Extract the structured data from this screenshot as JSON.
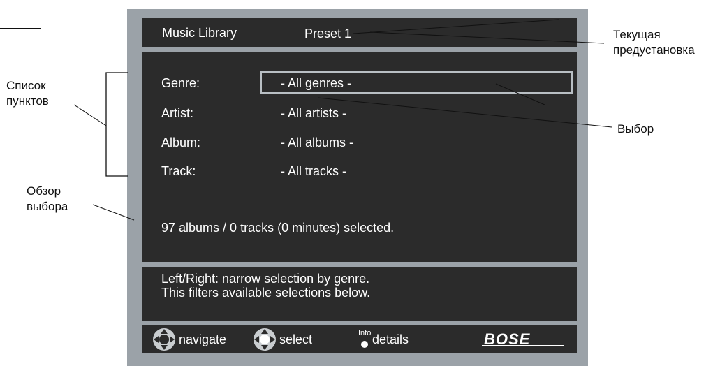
{
  "screen": {
    "title": "Music Library",
    "preset": "Preset 1",
    "fields": [
      {
        "label": "Genre:",
        "value": "- All genres -"
      },
      {
        "label": "Artist:",
        "value": "- All artists -"
      },
      {
        "label": "Album:",
        "value": "- All albums -"
      },
      {
        "label": "Track:",
        "value": "- All tracks -"
      }
    ],
    "summary": "97 albums / 0 tracks (0 minutes) selected.",
    "help_line1": "Left/Right: narrow selection by genre.",
    "help_line2": "This filters available selections below.",
    "footer": {
      "navigate": "navigate",
      "select": "select",
      "info": "Info",
      "details": "details",
      "logo": "BOSE"
    }
  },
  "annotations": {
    "current_preset_line1": "Текущая",
    "current_preset_line2": "предустановка",
    "item_list_line1": "Список",
    "item_list_line2": "пунктов",
    "selection": "Выбор",
    "overview_line1": "Обзор",
    "overview_line2": "выбора"
  },
  "colors": {
    "frame": "#9ba2a8",
    "panel": "#2b2b2b",
    "highlight_border": "#b9bfc4"
  }
}
